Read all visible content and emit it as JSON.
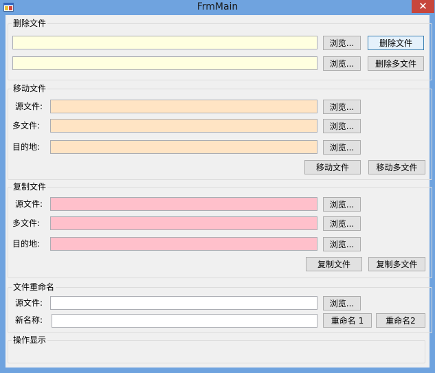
{
  "window": {
    "title": "FrmMain",
    "close_glyph": "✕"
  },
  "delete_group": {
    "legend": "删除文件",
    "input1_value": "",
    "input2_value": "",
    "browse1": "浏览...",
    "browse2": "浏览...",
    "delete_file": "删除文件",
    "delete_multi": "删除多文件"
  },
  "move_group": {
    "legend": "移动文件",
    "source_label": "源文件:",
    "multi_label": "多文件:",
    "dest_label": "目的地:",
    "browse_source": "浏览...",
    "browse_multi": "浏览...",
    "browse_dest": "浏览...",
    "move_file": "移动文件",
    "move_multi": "移动多文件"
  },
  "copy_group": {
    "legend": "复制文件",
    "source_label": "源文件:",
    "multi_label": "多文件:",
    "dest_label": "目的地:",
    "browse_source": "浏览...",
    "browse_multi": "浏览...",
    "browse_dest": "浏览...",
    "copy_file": "复制文件",
    "copy_multi": "复制多文件"
  },
  "rename_group": {
    "legend": "文件重命名",
    "source_label": "源文件:",
    "new_name_label": "新名称:",
    "browse_source": "浏览...",
    "rename1": "重命名 1",
    "rename2": "重命名2"
  },
  "output_group": {
    "legend": "操作显示"
  },
  "colors": {
    "titlebar": "#6fa3df",
    "close": "#c7463c",
    "delete_field": "#ffffe0",
    "move_field": "#ffe4c4",
    "copy_field": "#ffc0cb"
  }
}
